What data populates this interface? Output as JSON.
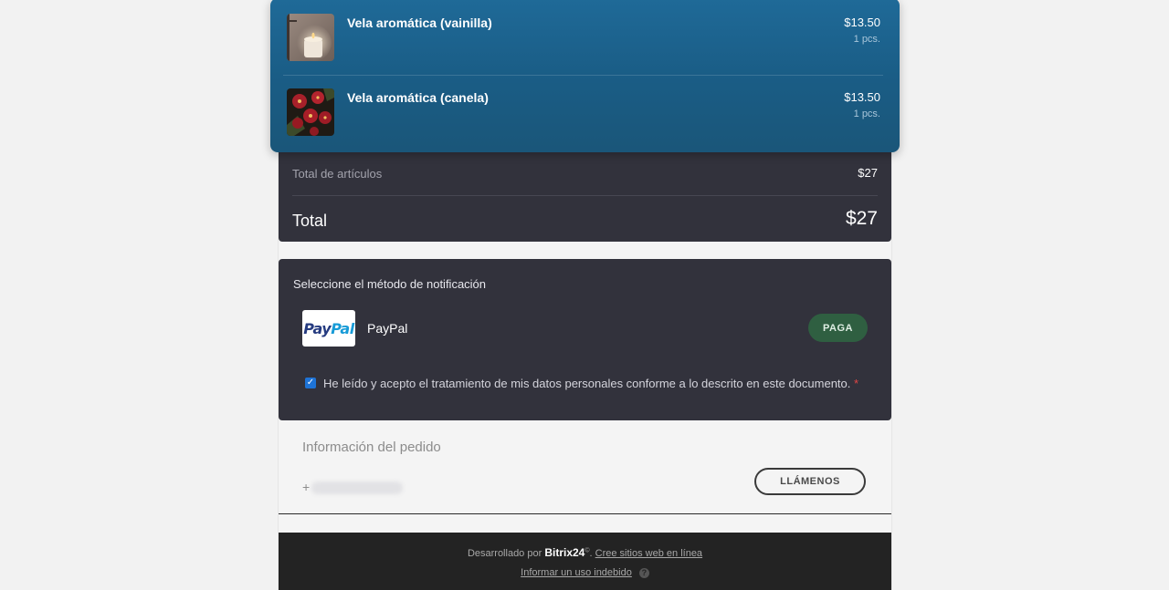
{
  "cart": {
    "items": [
      {
        "name": "Vela aromática (vainilla)",
        "price": "$13.50",
        "qty": "1 pcs."
      },
      {
        "name": "Vela aromática (canela)",
        "price": "$13.50",
        "qty": "1 pcs."
      }
    ]
  },
  "totals": {
    "items_label": "Total de artículos",
    "items_value": "$27",
    "total_label": "Total",
    "total_value": "$27"
  },
  "payment": {
    "title": "Seleccione el método de notificación",
    "logo_part1": "Pay",
    "logo_part2": "Pal",
    "method_name": "PayPal",
    "pay_button": "PAGA",
    "consent_text": "He leído y acepto el tratamiento de mis datos personales conforme a lo descrito en este documento.",
    "required_mark": "*"
  },
  "order_info": {
    "title": "Información del pedido",
    "phone_prefix": "+",
    "call_button": "LLÁMENOS"
  },
  "footer": {
    "powered_by": "Desarrollado por",
    "brand": "Bitrix24",
    "brand_mark": "©",
    "create_link": "Cree sitios web en línea",
    "report_link": "Informar un uso indebido",
    "help_icon": "?"
  }
}
